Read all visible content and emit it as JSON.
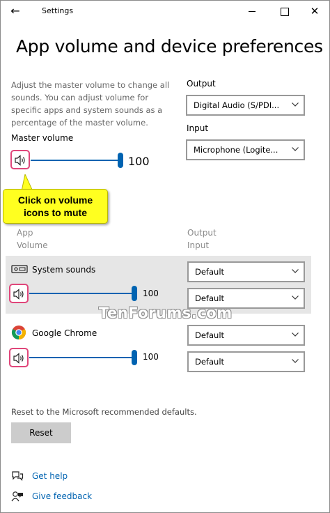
{
  "window": {
    "title": "Settings",
    "back_glyph": "←",
    "close_glyph": "✕"
  },
  "page": {
    "title": "App volume and device preferences",
    "description": "Adjust the master volume to change all sounds. You can adjust volume for specific apps and system sounds as a percentage of the master volume."
  },
  "master": {
    "label": "Master volume",
    "value": "100",
    "level": 1.0
  },
  "output": {
    "label": "Output",
    "selected": "Digital Audio (S/PDI..."
  },
  "input": {
    "label": "Input",
    "selected": "Microphone (Logite..."
  },
  "callout": {
    "line1": "Click on volume",
    "line2": "icons to mute"
  },
  "columns": {
    "app": "App",
    "volume": "Volume",
    "output": "Output",
    "input": "Input"
  },
  "apps": [
    {
      "name": "System sounds",
      "value": "100",
      "level": 1.0,
      "output": "Default",
      "input": "Default"
    },
    {
      "name": "Google Chrome",
      "value": "100",
      "level": 1.0,
      "output": "Default",
      "input": "Default"
    }
  ],
  "watermark": "TenForums.com",
  "reset": {
    "description": "Reset to the Microsoft recommended defaults.",
    "button": "Reset"
  },
  "links": {
    "help": "Get help",
    "feedback": "Give feedback"
  },
  "colors": {
    "accent": "#0063b1",
    "highlight": "#e0467a",
    "callout": "#ffff20"
  }
}
